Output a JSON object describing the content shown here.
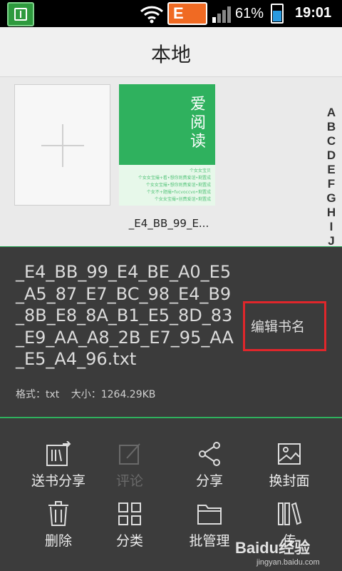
{
  "status": {
    "battery_pct": "61%",
    "battery_level": 0.61,
    "time": "19:01",
    "carrier_badge": "E"
  },
  "header": {
    "title": "本地"
  },
  "shelf": {
    "book": {
      "cover_title": "爱阅读",
      "cover_lines": [
        "个女女宝贝",
        "个女女宝撮+看•想你则费爱谊•剩置成",
        "个女女宝撮•想你则费爱谊•剩置成",
        "个女不+题撮•fvcvoccvo•剩置成",
        "个女女宝撮•创费爱谊•剩置成"
      ],
      "name": "_E4_BB_99_E..."
    },
    "alphabet": [
      "A",
      "B",
      "C",
      "D",
      "E",
      "F",
      "G",
      "H",
      "I",
      "J"
    ]
  },
  "detail": {
    "file_name": "_E4_BB_99_E4_BE_A0_E5_A5_87_E7_BC_98_E4_B9_8B_E8_8A_B1_E5_8D_83_E9_AA_A8_2B_E7_95_AA_E5_A4_96.txt",
    "rename_label": "编辑书名",
    "format": "格式：txt",
    "size": "大小：1264.29KB"
  },
  "actions": [
    {
      "label": "送书分享",
      "icon": "send-share-icon",
      "enabled": true
    },
    {
      "label": "评论",
      "icon": "comment-icon",
      "enabled": false
    },
    {
      "label": "分享",
      "icon": "share-icon",
      "enabled": true
    },
    {
      "label": "换封面",
      "icon": "cover-icon",
      "enabled": true
    },
    {
      "label": "删除",
      "icon": "trash-icon",
      "enabled": true
    },
    {
      "label": "分类",
      "icon": "grid-icon",
      "enabled": true
    },
    {
      "label": "批管理",
      "icon": "folder-icon",
      "enabled": true
    },
    {
      "label": "传",
      "icon": "books-icon",
      "enabled": true
    }
  ],
  "watermark": {
    "brand": "Baidu经验",
    "site": "jingyan.baidu.com"
  },
  "colors": {
    "accent": "#2fb15e",
    "highlight": "#e0262b",
    "panel": "#3b3b3b"
  }
}
